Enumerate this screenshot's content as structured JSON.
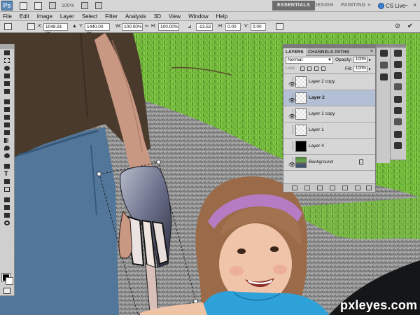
{
  "app": {
    "logo": "Ps",
    "zoom_display": "100%",
    "workspaces": [
      "ESSENTIALS",
      "DESIGN",
      "PAINTING"
    ],
    "active_workspace": "ESSENTIALS",
    "cs_live": "CS Live"
  },
  "menu": [
    "File",
    "Edit",
    "Image",
    "Layer",
    "Select",
    "Filter",
    "Analysis",
    "3D",
    "View",
    "Window",
    "Help"
  ],
  "options_bar": {
    "x_label": "X:",
    "x_value": "1048.91 px",
    "y_label": "Y:",
    "y_value": "1440.00 px",
    "w_label": "W:",
    "w_value": "100.00%",
    "h_label": "H:",
    "h_value": "100.00%",
    "angle_value": "-13.52",
    "hskew_label": "H:",
    "hskew_value": "0.00",
    "vskew_label": "V:",
    "vskew_value": "0.00"
  },
  "layers_panel": {
    "tabs": [
      "LAYERS",
      "CHANNELS",
      "PATHS"
    ],
    "blend_mode": "Normal",
    "opacity_label": "Opacity:",
    "opacity_value": "100%",
    "lock_label": "Lock:",
    "fill_label": "Fill:",
    "fill_value": "100%",
    "layers": [
      {
        "name": "Layer 2 copy",
        "visible": true,
        "selected": false,
        "thumb": "transparent"
      },
      {
        "name": "Layer 2",
        "visible": true,
        "selected": true,
        "thumb": "transparent"
      },
      {
        "name": "Layer 1 copy",
        "visible": true,
        "selected": false,
        "thumb": "transparent"
      },
      {
        "name": "Layer 1",
        "visible": false,
        "selected": false,
        "thumb": "transparent"
      },
      {
        "name": "Layer 4",
        "visible": false,
        "selected": false,
        "thumb": "black"
      },
      {
        "name": "Background",
        "visible": true,
        "selected": false,
        "thumb": "photo",
        "locked": true
      }
    ]
  },
  "watermark": "pxleyes.com"
}
